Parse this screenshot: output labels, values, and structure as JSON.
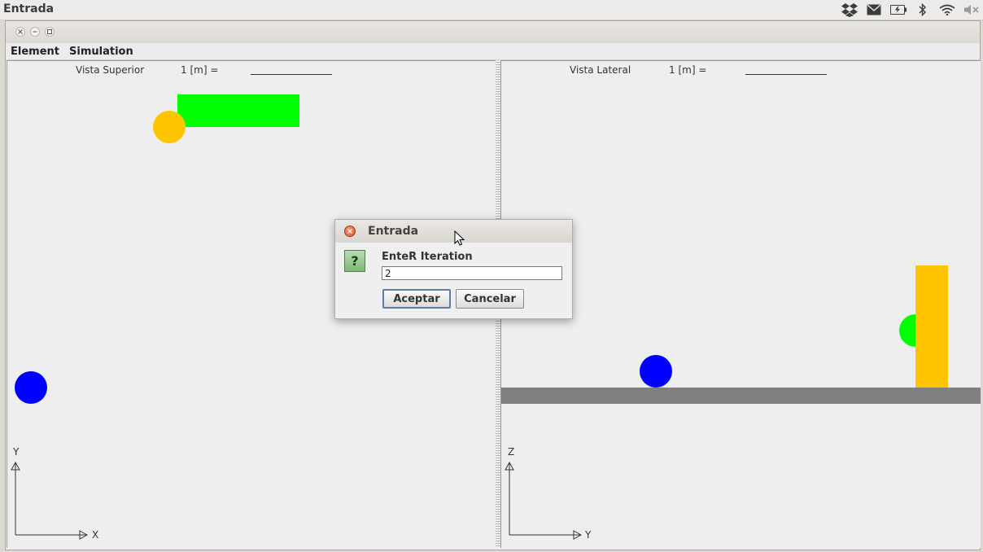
{
  "top_panel": {
    "app_title": "Entrada",
    "tray_icons": [
      "dropbox-icon",
      "mail-icon",
      "battery-icon",
      "bluetooth-icon",
      "wifi-icon",
      "volume-muted-icon"
    ]
  },
  "menubar": {
    "items": [
      "Element",
      "Simulation"
    ]
  },
  "views": {
    "top": {
      "title": "Vista Superior",
      "scale_label": "1  [m]  =",
      "axis_v": "Y",
      "axis_h": "X"
    },
    "side": {
      "title": "Vista Lateral",
      "scale_label": "1  [m]  =",
      "axis_v": "Z",
      "axis_h": "Y"
    }
  },
  "colors": {
    "green": "#00ff00",
    "yellow": "#ffc400",
    "blue": "#0000ff",
    "floor": "#808080"
  },
  "dialog": {
    "title": "Entrada",
    "prompt": "EnteR Iteration",
    "input_value": "2",
    "ok_label": "Aceptar",
    "cancel_label": "Cancelar",
    "icon": "question-icon"
  }
}
